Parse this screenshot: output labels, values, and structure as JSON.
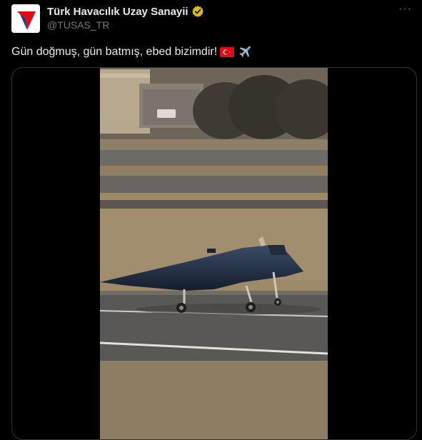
{
  "tweet": {
    "author": {
      "display_name": "Türk Havacılık Uzay Sanayii",
      "handle": "@TUSAS_TR",
      "verified_icon": "gold-verified-badge-icon",
      "avatar_icon": "tusas-logo-icon"
    },
    "more_label": "···",
    "text": "Gün doğmuş, gün batmış, ebed bizimdir!",
    "emojis": [
      "turkey-flag-icon",
      "airplane-icon"
    ],
    "media": {
      "type": "video",
      "subject": "unmanned-jet-aircraft-on-runway"
    }
  },
  "colors": {
    "background": "#000000",
    "text_primary": "#e7e9ea",
    "text_secondary": "#71767b",
    "verified_gold": "#e2b719",
    "border": "#2f3336",
    "brand_red": "#e30a17"
  }
}
